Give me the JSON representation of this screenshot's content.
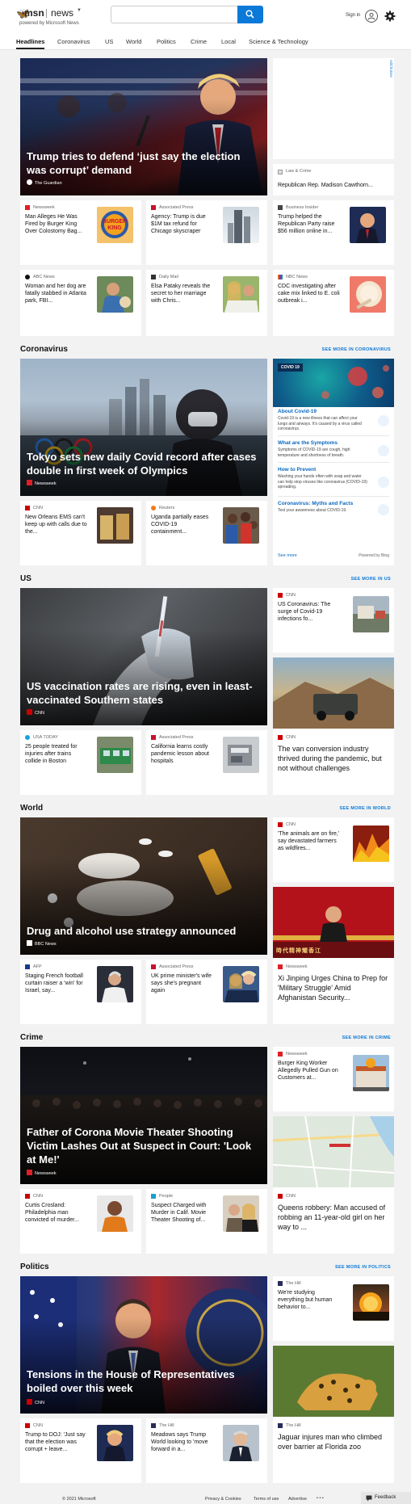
{
  "header": {
    "brand": "msn",
    "brand_section": "news",
    "powered_by": "powered by Microsoft News",
    "search_placeholder": "",
    "signin": "Sign in"
  },
  "nav": {
    "tabs": [
      "Headlines",
      "Coronavirus",
      "US",
      "World",
      "Politics",
      "Crime",
      "Local",
      "Science & Technology"
    ]
  },
  "headlines": {
    "hero": {
      "title": "Trump tries to defend ‘just say the election was corrupt’ demand",
      "source": "The Guardian"
    },
    "ad_label": "AdChoices",
    "side": {
      "source": "Law & Crime",
      "title": "Republican Rep. Madison Cawthorn..."
    },
    "cards": [
      {
        "source": "Newsweek",
        "title": "Man Alleges He Was Fired by Burger King Over Colostomy Bag..."
      },
      {
        "source": "Associated Press",
        "title": "Agency: Trump is due $1M tax refund for Chicago skyscraper"
      },
      {
        "source": "Business Insider",
        "title": "Trump helped the Republican Party raise $56 million online in..."
      },
      {
        "source": "ABC News",
        "title": "Woman and her dog are fatally stabbed in Atlanta park, FBI..."
      },
      {
        "source": "Daily Mail",
        "title": "Elsa Pataky reveals the secret to her marriage with Chris..."
      },
      {
        "source": "NBC News",
        "title": "CDC investigating after cake mix linked to E. coli outbreak i..."
      }
    ]
  },
  "coronavirus": {
    "label": "Coronavirus",
    "see_more": "SEE MORE IN CORONAVIRUS",
    "hero": {
      "title": "Tokyo sets new daily Covid record after cases double in first week of Olympics",
      "source": "Newsweek"
    },
    "cards": [
      {
        "source": "CNN",
        "title": "New Orleans EMS can't keep up with calls due to the..."
      },
      {
        "source": "Reuters",
        "title": "Uganda partially eases COVID-19 containment..."
      }
    ],
    "panel": {
      "badge": "COVID 19",
      "items": [
        {
          "title": "About Covid-19",
          "desc": "Covid-19 is a new illness that can affect your lungs and airways. It's caused by a virus called coronavirus."
        },
        {
          "title": "What are the Symptoms",
          "desc": "Symptoms of COVID-19 are cough, high temperature and shortness of breath."
        },
        {
          "title": "How to Prevent",
          "desc": "Washing your hands often with soap and water can help stop viruses like coronavirus (COVID-19) spreading."
        },
        {
          "title": "Coronavirus: Myths and Facts",
          "desc": "Test your awareness about COVID-19."
        }
      ],
      "see_more": "See more",
      "powered": "Powered by Bing"
    }
  },
  "us": {
    "label": "US",
    "see_more": "SEE MORE IN US",
    "hero": {
      "title": "US vaccination rates are rising, even in least-vaccinated Southern states",
      "source": "CNN"
    },
    "side_small": {
      "source": "CNN",
      "title": "US Coronavirus: The surge of Covid-19 infections fo..."
    },
    "side_big": {
      "source": "CNN",
      "title": "The van conversion industry thrived during the pandemic, but not without challenges"
    },
    "cards": [
      {
        "source": "USA TODAY",
        "title": "25 people treated for injuries after trains collide in Boston"
      },
      {
        "source": "Associated Press",
        "title": "California learns costly pandemic lesson about hospitals"
      }
    ]
  },
  "world": {
    "label": "World",
    "see_more": "SEE MORE IN WORLD",
    "hero": {
      "title": "Drug and alcohol use strategy announced",
      "source": "BBC News"
    },
    "side_small": {
      "source": "CNN",
      "title": "'The animals are on fire,' say devastated farmers as wildfires..."
    },
    "side_big": {
      "source": "Newsweek",
      "title": "Xi Jinping Urges China to Prep for 'Military Struggle' Amid Afghanistan Security..."
    },
    "banner_text": "時代精神耀香江",
    "cards": [
      {
        "source": "AFP",
        "title": "Staging French football curtain raiser a 'win' for Israel, say..."
      },
      {
        "source": "Associated Press",
        "title": "UK prime minister's wife says she's pregnant again"
      }
    ]
  },
  "crime": {
    "label": "Crime",
    "see_more": "SEE MORE IN CRIME",
    "hero": {
      "title": "Father of Corona Movie Theater Shooting Victim Lashes Out at Suspect in Court: 'Look at Me!'",
      "source": "Newsweek"
    },
    "side_small": {
      "source": "Newsweek",
      "title": "Burger King Worker Allegedly Pulled Gun on Customers at..."
    },
    "side_big": {
      "source": "CNN",
      "title": "Queens robbery: Man accused of robbing an 11-year-old girl on her way to ..."
    },
    "cards": [
      {
        "source": "CNN",
        "title": "Curtis Crosland: Philadelphia man convicted of murder..."
      },
      {
        "source": "People",
        "title": "Suspect Charged with Murder in Calif. Movie Theater Shooting of..."
      }
    ]
  },
  "politics": {
    "label": "Politics",
    "see_more": "SEE MORE IN POLITICS",
    "hero": {
      "title": "Tensions in the House of Representatives boiled over this week",
      "source": "CNN"
    },
    "side_small": {
      "source": "The Hill",
      "title": "We're studying everything but human behavior to..."
    },
    "side_big": {
      "source": "The Hill",
      "title": "Jaguar injures man who climbed over barrier at Florida zoo"
    },
    "cards": [
      {
        "source": "CNN",
        "title": "Trump to DOJ: 'Just say that the election was corrupt + leave..."
      },
      {
        "source": "The Hill",
        "title": "Meadows says Trump World looking to 'move forward in a..."
      }
    ]
  },
  "footer": {
    "copyright": "© 2021 Microsoft",
    "links": [
      "Privacy & Cookies",
      "Terms of use",
      "Advertise"
    ],
    "more": "• • •",
    "feedback": "Feedback"
  },
  "colors": {
    "accent": "#0a79d8",
    "cnn": "#cc0000",
    "newsweek": "#e01e26"
  }
}
